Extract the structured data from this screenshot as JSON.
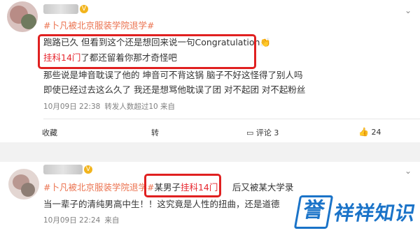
{
  "post1": {
    "hashtag": "#卜凡被北京服装学院退学#",
    "line1": "跑路已久 但看到这个还是想回来说一句Congratulation",
    "line1_emoji": "👏",
    "line2_red": "挂科14门",
    "line2_rest": "了都还留着你那才奇怪吧",
    "line3": "那些说是坤音耽误了他的  坤音可不背这锅  脑子不好这怪得了别人吗",
    "line4": "即使已经过去这么久了  我还是想骂他耽误了团  对不起团  对不起粉丝",
    "time": "10月09日 22:38",
    "meta_rest": "转发人数超过10  来自",
    "actions": {
      "collect": "收藏",
      "repost_icon": "转",
      "comment": "评论 3",
      "likes": "24"
    }
  },
  "post2": {
    "hashtag": "#卜凡被北京服装学院退学#",
    "boxed_prefix": "某男子",
    "boxed_red": "挂科14门",
    "boxed_suffix": "，",
    "line1_rest": "后又被某大学录",
    "line2": "当一辈子的清纯男高中生！！这究竟是人性的扭曲，还是道德",
    "time": "10月09日 22:24",
    "meta_rest": "来自"
  },
  "watermark": {
    "badge_char": "誉",
    "text": "祥祥知识"
  },
  "colors": {
    "hashtag": "#eb7350",
    "highlight_red": "#e6262e",
    "box_red": "#e02020",
    "brand_blue": "#1a73c8"
  }
}
